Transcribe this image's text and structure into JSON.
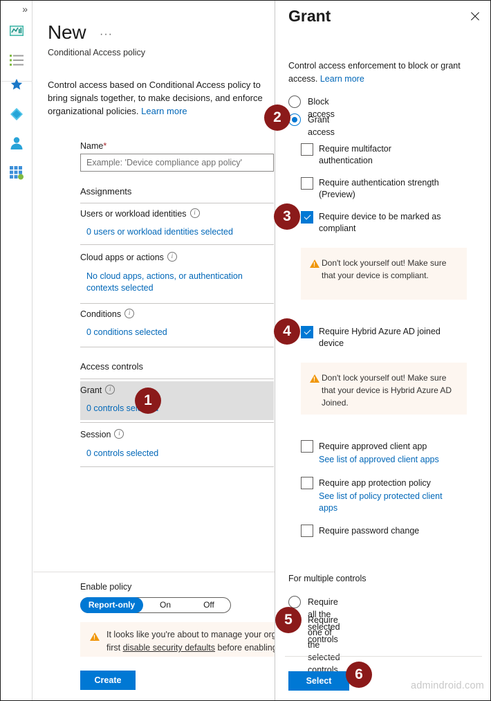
{
  "rail": {
    "collapse_label": "»",
    "items": [
      {
        "name": "dashboard-icon"
      },
      {
        "name": "all-services-icon"
      },
      {
        "name": "favorites-star-icon"
      },
      {
        "name": "resource-groups-icon"
      },
      {
        "name": "users-icon"
      },
      {
        "name": "all-resources-icon"
      }
    ]
  },
  "blade": {
    "title": "New",
    "ellipsis": "···",
    "subtitle": "Conditional Access policy",
    "intro_text": "Control access based on Conditional Access policy to bring signals together, to make decisions, and enforce organizational policies.",
    "intro_link": "Learn more",
    "name_label": "Name",
    "name_required_mark": "*",
    "name_value": "",
    "name_placeholder": "Example: 'Device compliance app policy'",
    "assignments_heading": "Assignments",
    "assignment_rows": [
      {
        "title": "Users or workload identities",
        "value": "0 users or workload identities selected"
      },
      {
        "title": "Cloud apps or actions",
        "value": "No cloud apps, actions, or authentication contexts selected"
      },
      {
        "title": "Conditions",
        "value": "0 conditions selected"
      }
    ],
    "access_controls_heading": "Access controls",
    "access_rows": [
      {
        "title": "Grant",
        "value": "0 controls selected"
      },
      {
        "title": "Session",
        "value": "0 controls selected"
      }
    ],
    "enable_policy_label": "Enable policy",
    "enable_options": [
      "Report-only",
      "On",
      "Off"
    ],
    "enable_selected": "Report-only",
    "footer_warning_line1": "It looks like you're about to manage your organization",
    "footer_warning_link": "disable security defaults",
    "footer_warning_pre": "first ",
    "footer_warning_post": " before enabling a Condit",
    "create_label": "Create"
  },
  "panel": {
    "title": "Grant",
    "close_label": "×",
    "description": "Control access enforcement to block or grant access. ",
    "description_link": "Learn more",
    "access_mode_options": [
      {
        "label": "Block access",
        "selected": false
      },
      {
        "label": "Grant access",
        "selected": true
      }
    ],
    "controls": [
      {
        "label": "Require multifactor authentication",
        "checked": false,
        "sublink": ""
      },
      {
        "label": "Require authentication strength (Preview)",
        "checked": false,
        "sublink": ""
      },
      {
        "label": "Require device to be marked as compliant",
        "checked": true,
        "sublink": ""
      },
      {
        "label": "Require Hybrid Azure AD joined device",
        "checked": true,
        "sublink": ""
      },
      {
        "label": "Require approved client app",
        "checked": false,
        "sublink": "See list of approved client apps"
      },
      {
        "label": "Require app protection policy",
        "checked": false,
        "sublink": "See list of policy protected client apps"
      },
      {
        "label": "Require password change",
        "checked": false,
        "sublink": ""
      }
    ],
    "note_compliant": "Don't lock yourself out! Make sure that your device is compliant.",
    "note_hybrid": "Don't lock yourself out! Make sure that your device is Hybrid Azure AD Joined.",
    "multiple_controls_heading": "For multiple controls",
    "multiple_controls_options": [
      {
        "label": "Require all the selected controls",
        "selected": false
      },
      {
        "label": "Require one of the selected controls",
        "selected": true
      }
    ],
    "select_label": "Select",
    "watermark": "admindroid.com"
  },
  "callouts": [
    {
      "number": "1"
    },
    {
      "number": "2"
    },
    {
      "number": "3"
    },
    {
      "number": "4"
    },
    {
      "number": "5"
    },
    {
      "number": "6"
    }
  ],
  "colors": {
    "accent_blue": "#0078d4",
    "link_blue": "#0067b8",
    "badge_maroon": "#8b1a1a",
    "warning_orange": "#f0960a",
    "warning_bg": "#fdf6f0",
    "highlight_gray": "#dedede"
  }
}
